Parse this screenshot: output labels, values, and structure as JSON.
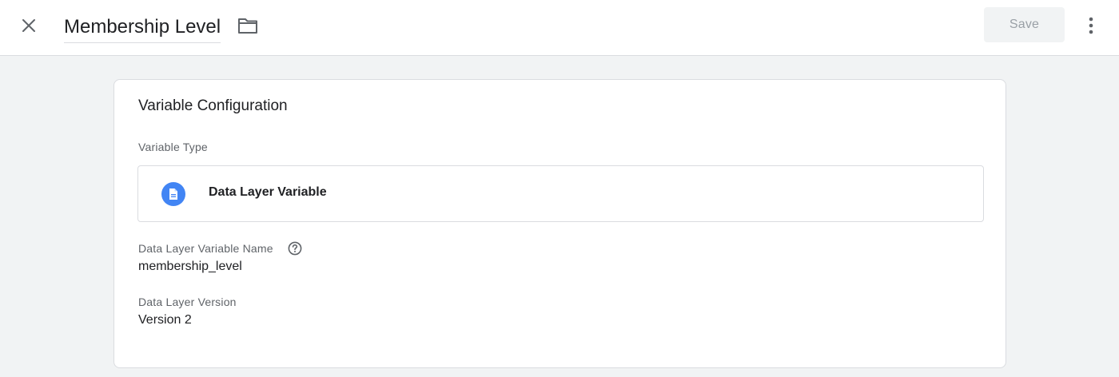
{
  "header": {
    "title": "Membership Level",
    "save_label": "Save",
    "icons": {
      "close": "close-icon",
      "folder": "folder-icon",
      "more": "more-vert-icon"
    }
  },
  "card": {
    "title": "Variable Configuration",
    "variable_type_label": "Variable Type",
    "variable_type": {
      "name": "Data Layer Variable",
      "icon": "document-icon",
      "icon_color": "#4285f4"
    },
    "fields": [
      {
        "label": "Data Layer Variable Name",
        "value": "membership_level"
      },
      {
        "label": "Data Layer Version",
        "value": "Version 2"
      }
    ]
  },
  "colors": {
    "accent": "#4285f4",
    "background": "#f1f3f4",
    "border": "#dadce0"
  }
}
